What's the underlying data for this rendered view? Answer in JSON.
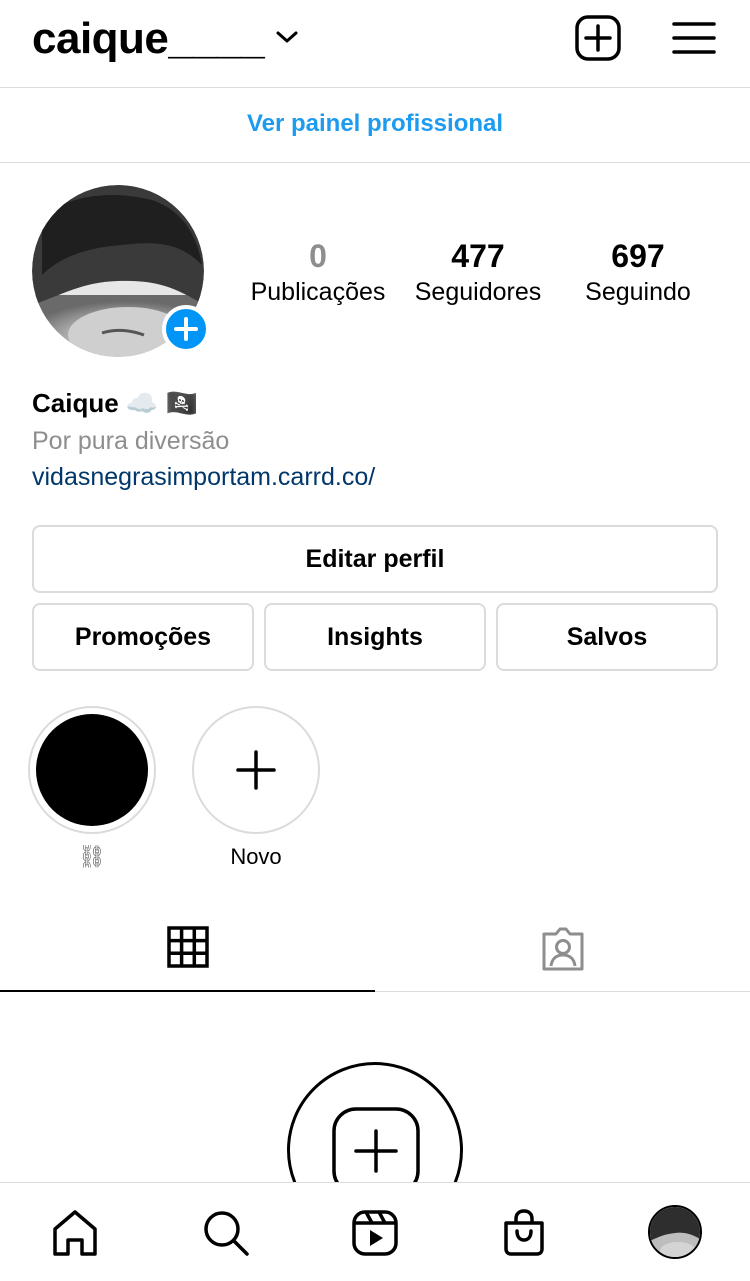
{
  "header": {
    "username": "caique____",
    "icons": {
      "dropdown": "chevron-down-icon",
      "new_post": "plus-square-icon",
      "menu": "hamburger-menu-icon"
    }
  },
  "pro_panel": {
    "label": "Ver painel profissional"
  },
  "profile": {
    "stats": [
      {
        "value": "0",
        "label": "Publicações"
      },
      {
        "value": "477",
        "label": "Seguidores"
      },
      {
        "value": "697",
        "label": "Seguindo"
      }
    ],
    "name": "Caique",
    "name_emoji": "☁️ 🏴‍☠️",
    "bio": "Por pura diversão",
    "link": "vidasnegrasimportam.carrd.co/"
  },
  "buttons": {
    "edit": "Editar perfil",
    "promotions": "Promoções",
    "insights": "Insights",
    "saved": "Salvos"
  },
  "highlights": [
    {
      "label": "⛓"
    },
    {
      "label": "Novo"
    }
  ],
  "tabs": {
    "grid": "grid-icon",
    "tagged": "tagged-person-icon",
    "active": "grid"
  },
  "bottom_nav": [
    "home-icon",
    "search-icon",
    "reels-icon",
    "shop-icon",
    "profile-avatar"
  ],
  "colors": {
    "accent_blue": "#0095f6",
    "link_text": "#1d9bf0",
    "bio_link": "#00376b",
    "muted": "#8e8e8e",
    "border": "#dbdbdb"
  }
}
